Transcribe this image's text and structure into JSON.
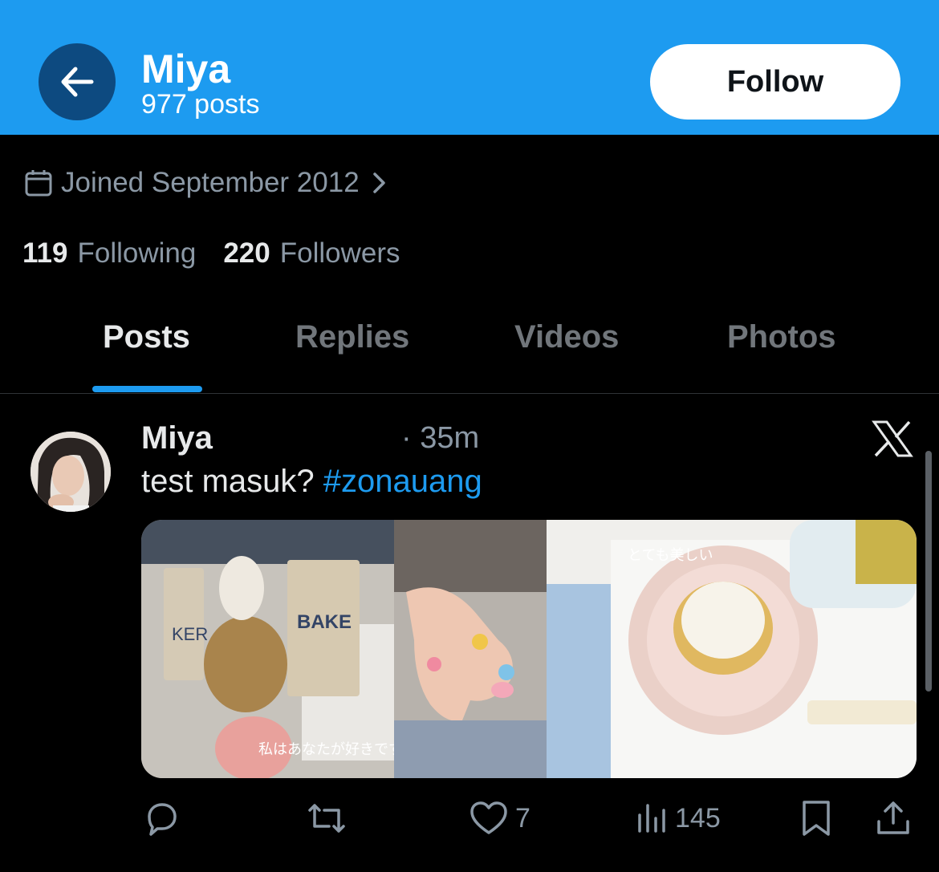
{
  "header": {
    "name": "Miya",
    "posts_count": "977 posts",
    "follow_label": "Follow",
    "bg_color": "#1d9bf0"
  },
  "profile": {
    "joined": "Joined September 2012",
    "following_count": "119",
    "following_label": "Following",
    "followers_count": "220",
    "followers_label": "Followers"
  },
  "tabs": [
    {
      "label": "Posts",
      "active": true
    },
    {
      "label": "Replies",
      "active": false
    },
    {
      "label": "Videos",
      "active": false
    },
    {
      "label": "Photos",
      "active": false
    }
  ],
  "post": {
    "author": "Miya",
    "time": "· 35m",
    "text": "test masuk? ",
    "hashtag": "#zonauang",
    "media_captions": {
      "left_bag_1": "KER",
      "left_bag_2": "BAKE",
      "left_subtitle": "私はあなたが好きです",
      "right_caption": "とても美しい"
    },
    "likes": "7",
    "views": "145"
  },
  "icons": {
    "back": "arrow-left-icon",
    "calendar": "calendar-icon",
    "reply": "reply-icon",
    "repost": "repost-icon",
    "like": "heart-icon",
    "views": "views-icon",
    "bookmark": "bookmark-icon",
    "share": "share-icon",
    "x": "x-logo-icon"
  },
  "colors": {
    "accent": "#1d9bf0",
    "muted": "#8b98a5",
    "text": "#e7e9ea"
  }
}
